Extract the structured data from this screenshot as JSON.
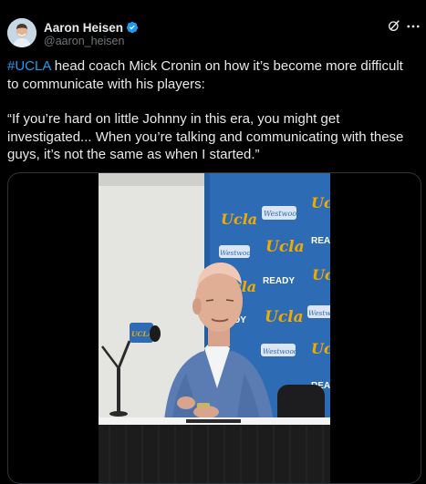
{
  "author": {
    "display_name": "Aaron Heisen",
    "handle": "@aaron_heisen",
    "verified": true,
    "avatar_icon": "person-avatar",
    "verified_color": "#1d9bf0"
  },
  "header_icons": [
    "grok-icon",
    "more-icon"
  ],
  "tweet": {
    "hashtag": "#UCLA",
    "line1_rest": " head coach Mick Cronin on how it’s become more difficult to communicate with his players:",
    "quote": "“If you’re hard on little Johnny in this era, you might get investigated... When you’re talking and communicating with these guys, it’s not the same as when I started.”"
  },
  "media": {
    "type": "video",
    "backdrop_words": {
      "ucla": "Ucla",
      "westwood": "Westwood",
      "ready": "READY",
      "rea": "REA",
      "dy": "DY"
    },
    "mic_flag": "UCLA"
  },
  "colors": {
    "background": "#000000",
    "text": "#e7e9ea",
    "secondary": "#71767b",
    "link": "#1d9bf0",
    "backdrop_blue": "#2d6cb5",
    "ucla_gold": "#f2a900"
  }
}
